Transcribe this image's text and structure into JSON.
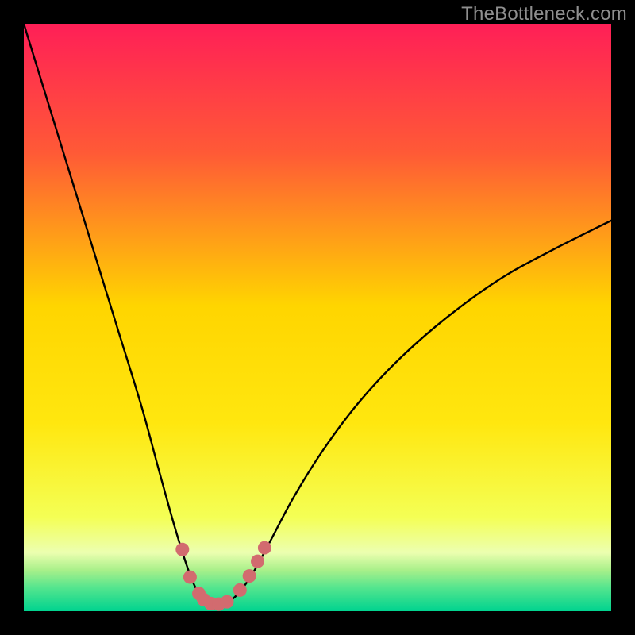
{
  "watermark": "TheBottleneck.com",
  "colors": {
    "frame": "#000000",
    "gradient_top": "#ff1f57",
    "gradient_mid_upper": "#ff722f",
    "gradient_mid": "#ffd500",
    "gradient_lower": "#f6ff4a",
    "gradient_green1": "#8cf268",
    "gradient_green2": "#2fe27d",
    "gradient_green3": "#00d38f",
    "curve": "#000000",
    "markers": "#d26b6f"
  },
  "chart_data": {
    "type": "line",
    "title": "",
    "xlabel": "",
    "ylabel": "",
    "curve_description": "V-shaped bottleneck curve over vertical rainbow gradient (red=high bottleneck, green=low). Minimum near x≈0.325. Right branch rises with decreasing slope; left branch rises steeply.",
    "x_range_normalized": [
      0,
      1
    ],
    "y_range_normalized": [
      0,
      1
    ],
    "minimum_x_normalized": 0.325,
    "curve_points_normalized": [
      {
        "x": 0.0,
        "y": 1.0
      },
      {
        "x": 0.04,
        "y": 0.87
      },
      {
        "x": 0.08,
        "y": 0.74
      },
      {
        "x": 0.12,
        "y": 0.61
      },
      {
        "x": 0.16,
        "y": 0.48
      },
      {
        "x": 0.2,
        "y": 0.35
      },
      {
        "x": 0.23,
        "y": 0.24
      },
      {
        "x": 0.255,
        "y": 0.15
      },
      {
        "x": 0.275,
        "y": 0.085
      },
      {
        "x": 0.29,
        "y": 0.045
      },
      {
        "x": 0.305,
        "y": 0.02
      },
      {
        "x": 0.325,
        "y": 0.012
      },
      {
        "x": 0.345,
        "y": 0.015
      },
      {
        "x": 0.365,
        "y": 0.03
      },
      {
        "x": 0.39,
        "y": 0.065
      },
      {
        "x": 0.42,
        "y": 0.12
      },
      {
        "x": 0.46,
        "y": 0.195
      },
      {
        "x": 0.51,
        "y": 0.275
      },
      {
        "x": 0.57,
        "y": 0.355
      },
      {
        "x": 0.64,
        "y": 0.43
      },
      {
        "x": 0.72,
        "y": 0.5
      },
      {
        "x": 0.81,
        "y": 0.565
      },
      {
        "x": 0.9,
        "y": 0.615
      },
      {
        "x": 1.0,
        "y": 0.665
      }
    ],
    "marker_points_normalized": [
      {
        "x": 0.27,
        "y": 0.105
      },
      {
        "x": 0.283,
        "y": 0.058
      },
      {
        "x": 0.298,
        "y": 0.03
      },
      {
        "x": 0.306,
        "y": 0.02
      },
      {
        "x": 0.318,
        "y": 0.013
      },
      {
        "x": 0.332,
        "y": 0.012
      },
      {
        "x": 0.346,
        "y": 0.016
      },
      {
        "x": 0.368,
        "y": 0.036
      },
      {
        "x": 0.384,
        "y": 0.06
      },
      {
        "x": 0.398,
        "y": 0.085
      },
      {
        "x": 0.41,
        "y": 0.108
      }
    ]
  }
}
